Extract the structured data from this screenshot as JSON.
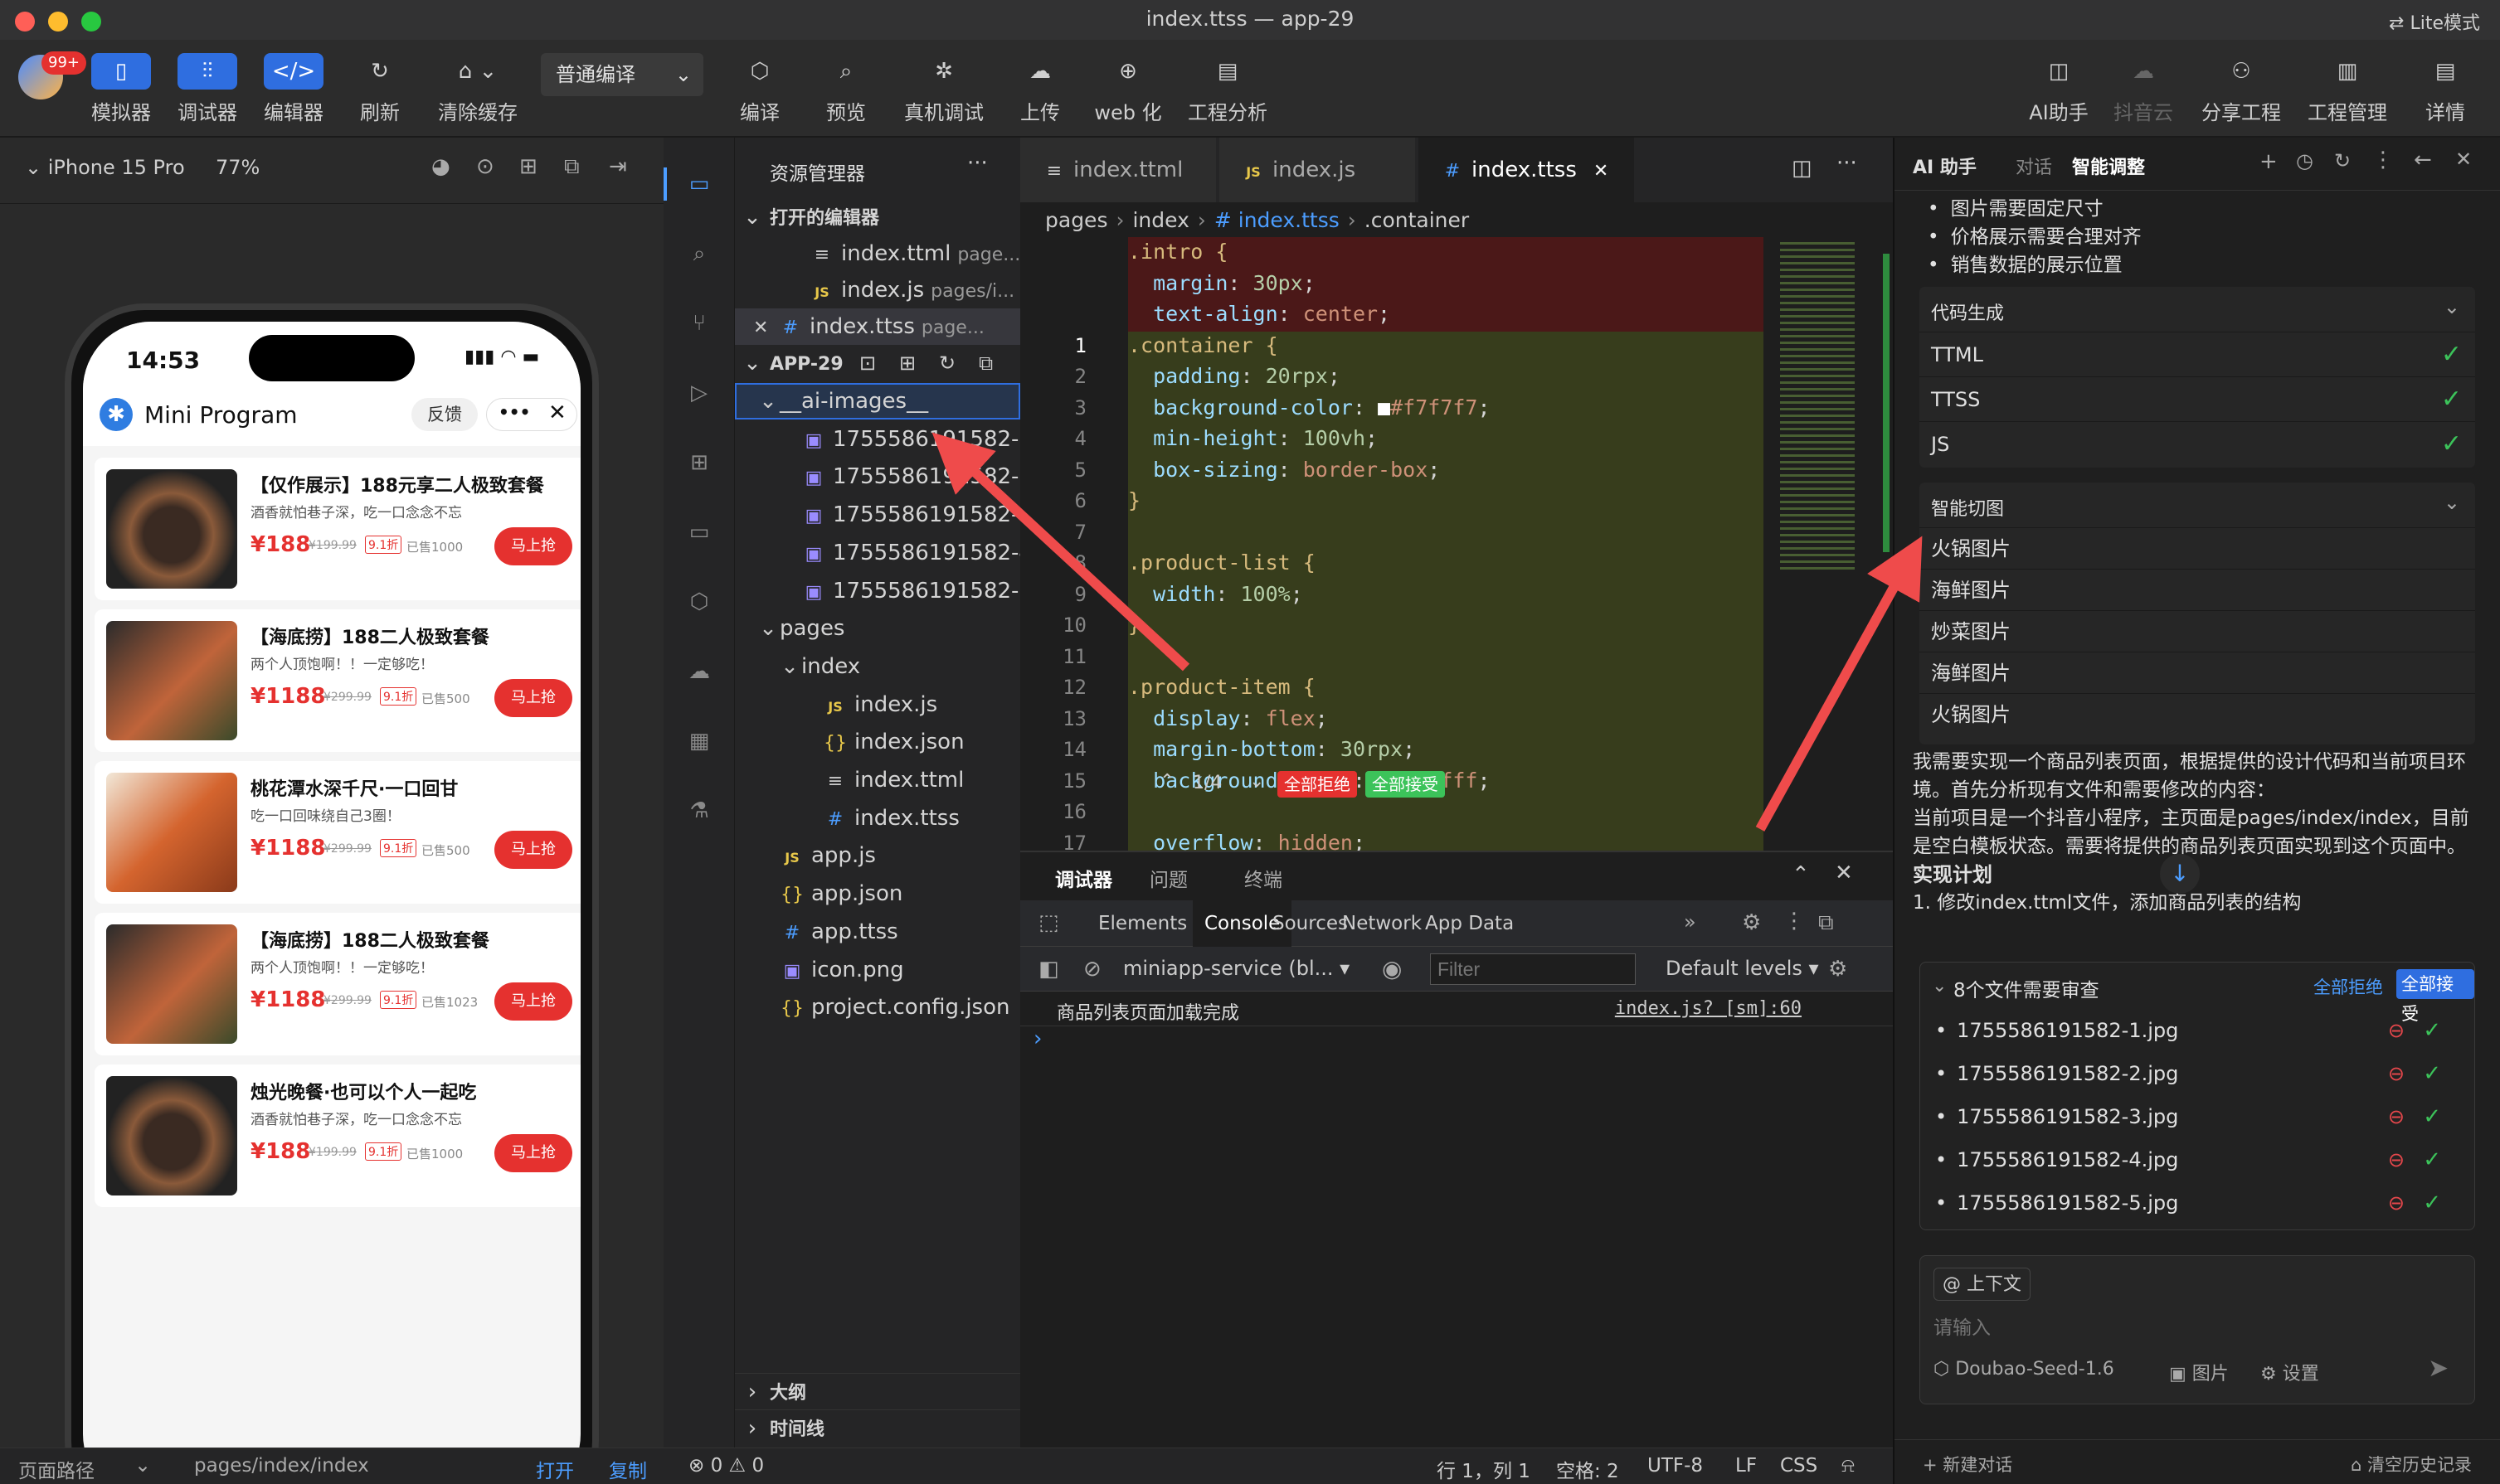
{
  "window": {
    "title": "index.ttss — app-29",
    "lite_mode": "Lite模式"
  },
  "toolbar": {
    "badge": "99+",
    "simulator": "模拟器",
    "debugger": "调试器",
    "editor": "编辑器",
    "refresh": "刷新",
    "clear_cache": "清除缓存",
    "compile_mode": "普通编译",
    "compile": "编译",
    "preview": "预览",
    "real_debug": "真机调试",
    "upload": "上传",
    "web": "web 化",
    "analysis": "工程分析",
    "ai": "AI助手",
    "douyin_cloud": "抖音云",
    "share": "分享工程",
    "project": "工程管理",
    "detail": "详情"
  },
  "simulator": {
    "device": "iPhone 15 Pro",
    "zoom": "77%",
    "time": "14:53",
    "app_name": "Mini Program",
    "feedback": "反馈",
    "more": "•••",
    "path_label": "页面路径",
    "path": "pages/index/index",
    "open": "打开",
    "copy": "复制",
    "products": [
      {
        "title": "【仅作展示】188元享二人极致套餐",
        "desc": "酒香就怕巷子深，吃一口念念不忘",
        "price": "¥188",
        "orig": "¥199.99",
        "discount": "9.1折",
        "sold": "已售1000",
        "btn": "马上抢"
      },
      {
        "title": "【海底捞】188二人极致套餐",
        "desc": "两个人顶饱啊！！一定够吃！",
        "price": "¥1188",
        "orig": "¥299.99",
        "discount": "9.1折",
        "sold": "已售500",
        "btn": "马上抢"
      },
      {
        "title": "桃花潭水深千尺·一口回甘",
        "desc": "吃一口回味绕自己3圈！",
        "price": "¥1188",
        "orig": "¥299.99",
        "discount": "9.1折",
        "sold": "已售500",
        "btn": "马上抢"
      },
      {
        "title": "【海底捞】188二人极致套餐",
        "desc": "两个人顶饱啊！！一定够吃！",
        "price": "¥1188",
        "orig": "¥299.99",
        "discount": "9.1折",
        "sold": "已售1023",
        "btn": "马上抢"
      },
      {
        "title": "烛光晚餐·也可以个人一起吃",
        "desc": "酒香就怕巷子深，吃一口念念不忘",
        "price": "¥188",
        "orig": "¥199.99",
        "discount": "9.1折",
        "sold": "已售1000",
        "btn": "马上抢"
      }
    ]
  },
  "explorer": {
    "title": "资源管理器",
    "open_editors": "打开的编辑器",
    "open_files": [
      {
        "icon": "≡",
        "name": "index.ttml",
        "hint": "page..."
      },
      {
        "icon": "JS",
        "name": "index.js",
        "hint": "pages/i..."
      },
      {
        "icon": "#",
        "name": "index.ttss",
        "hint": "page..."
      }
    ],
    "project": "APP-29",
    "tree": [
      {
        "indent": 1,
        "arrow": "⌄",
        "icon": "",
        "name": "__ai-images__"
      },
      {
        "indent": 2,
        "arrow": "",
        "icon": "▣",
        "name": "1755586191582-1.jpg"
      },
      {
        "indent": 2,
        "arrow": "",
        "icon": "▣",
        "name": "1755586191582-2.jpg"
      },
      {
        "indent": 2,
        "arrow": "",
        "icon": "▣",
        "name": "1755586191582-3.jpg"
      },
      {
        "indent": 2,
        "arrow": "",
        "icon": "▣",
        "name": "1755586191582-4.jpg"
      },
      {
        "indent": 2,
        "arrow": "",
        "icon": "▣",
        "name": "1755586191582-5.jpg"
      },
      {
        "indent": 1,
        "arrow": "⌄",
        "icon": "",
        "name": "pages"
      },
      {
        "indent": 2,
        "arrow": "⌄",
        "icon": "",
        "name": "index"
      },
      {
        "indent": 3,
        "arrow": "",
        "icon": "JS",
        "name": "index.js"
      },
      {
        "indent": 3,
        "arrow": "",
        "icon": "{}",
        "name": "index.json"
      },
      {
        "indent": 3,
        "arrow": "",
        "icon": "≡",
        "name": "index.ttml"
      },
      {
        "indent": 3,
        "arrow": "",
        "icon": "#",
        "name": "index.ttss"
      },
      {
        "indent": 1,
        "arrow": "",
        "icon": "JS",
        "name": "app.js"
      },
      {
        "indent": 1,
        "arrow": "",
        "icon": "{}",
        "name": "app.json"
      },
      {
        "indent": 1,
        "arrow": "",
        "icon": "#",
        "name": "app.ttss"
      },
      {
        "indent": 1,
        "arrow": "",
        "icon": "▣",
        "name": "icon.png"
      },
      {
        "indent": 1,
        "arrow": "",
        "icon": "{}",
        "name": "project.config.json"
      }
    ],
    "outline": "大纲",
    "timeline": "时间线"
  },
  "editor": {
    "tabs": [
      {
        "icon": "≡",
        "name": "index.ttml"
      },
      {
        "icon": "JS",
        "name": "index.js"
      },
      {
        "icon": "#",
        "name": "index.ttss"
      }
    ],
    "breadcrumb": [
      "pages",
      "index",
      "# index.ttss",
      ".container"
    ],
    "lines": [
      {
        "ln": "",
        "text": ".intro {"
      },
      {
        "ln": "",
        "text": "  margin: 30px;"
      },
      {
        "ln": "",
        "text": "  text-align: center;"
      },
      {
        "ln": "1",
        "text": ".container {"
      },
      {
        "ln": "2",
        "text": "  padding: 20rpx;"
      },
      {
        "ln": "3",
        "text": "  background-color: ■#f7f7f7;"
      },
      {
        "ln": "4",
        "text": "  min-height: 100vh;"
      },
      {
        "ln": "5",
        "text": "  box-sizing: border-box;"
      },
      {
        "ln": "6",
        "text": "}"
      },
      {
        "ln": "7",
        "text": ""
      },
      {
        "ln": "8",
        "text": ".product-list {"
      },
      {
        "ln": "9",
        "text": "  width: 100%;"
      },
      {
        "ln": "10",
        "text": "}"
      },
      {
        "ln": "11",
        "text": ""
      },
      {
        "ln": "12",
        "text": ".product-item {"
      },
      {
        "ln": "13",
        "text": "  display: flex;"
      },
      {
        "ln": "14",
        "text": "  margin-bottom: 30rpx;"
      },
      {
        "ln": "15",
        "text": "  background-color: ■#ffffff;"
      },
      {
        "ln": "16",
        "text": ""
      },
      {
        "ln": "17",
        "text": "  overflow: hidden;"
      }
    ],
    "diff_counter": "1/4",
    "reject_all": "全部拒绝",
    "accept_all": "全部接受"
  },
  "panel": {
    "tabs": [
      "调试器",
      "问题",
      "终端"
    ],
    "devtools_tabs": [
      "Elements",
      "Console",
      "Sources",
      "Network",
      "App Data"
    ],
    "context": "miniapp-service (bl...",
    "filter_placeholder": "Filter",
    "levels": "Default levels",
    "log_msg": "商品列表页面加载完成",
    "log_src": "index.js? [sm]:60"
  },
  "status": {
    "errors": "0",
    "warnings": "0",
    "position": "行 1，列 1",
    "spaces": "空格: 2",
    "encoding": "UTF-8",
    "eol": "LF",
    "lang": "CSS"
  },
  "ai": {
    "tabs": [
      "AI 助手",
      "对话",
      "智能调整"
    ],
    "bullets": [
      "图片需要固定尺寸",
      "价格展示需要合理对齐",
      "销售数据的展示位置"
    ],
    "codegen_title": "代码生成",
    "codegen": [
      "TTML",
      "TTSS",
      "JS"
    ],
    "slice_title": "智能切图",
    "slices": [
      "火锅图片",
      "海鲜图片",
      "炒菜图片",
      "海鲜图片",
      "火锅图片"
    ],
    "message": "我需要实现一个商品列表页面，根据提供的设计代码和当前项目环境。首先分析现有文件和需要修改的内容：",
    "message2": "当前项目是一个抖音小程序，主页面是pages/index/index，目前是空白模板状态。需要将提供的商品列表页面实现到这个页面中。",
    "plan_title": "实现计划",
    "plan_item": "1. 修改index.ttml文件，添加商品列表的结构",
    "review_title": "8个文件需要审查",
    "review_reject": "全部拒绝",
    "review_accept": "全部接受",
    "review_files": [
      "1755586191582-1.jpg",
      "1755586191582-2.jpg",
      "1755586191582-3.jpg",
      "1755586191582-4.jpg",
      "1755586191582-5.jpg"
    ],
    "context_btn": "@ 上下文",
    "input_placeholder": "请输入",
    "model": "Doubao-Seed-1.6",
    "image": "图片",
    "settings": "设置",
    "new_chat": "+ 新建对话",
    "clear_history": "清空历史记录"
  },
  "colors": {
    "accent": "#2f6ee0",
    "arrow": "#ef4b4b",
    "price": "#e5312f",
    "ok": "#3cc35a"
  }
}
